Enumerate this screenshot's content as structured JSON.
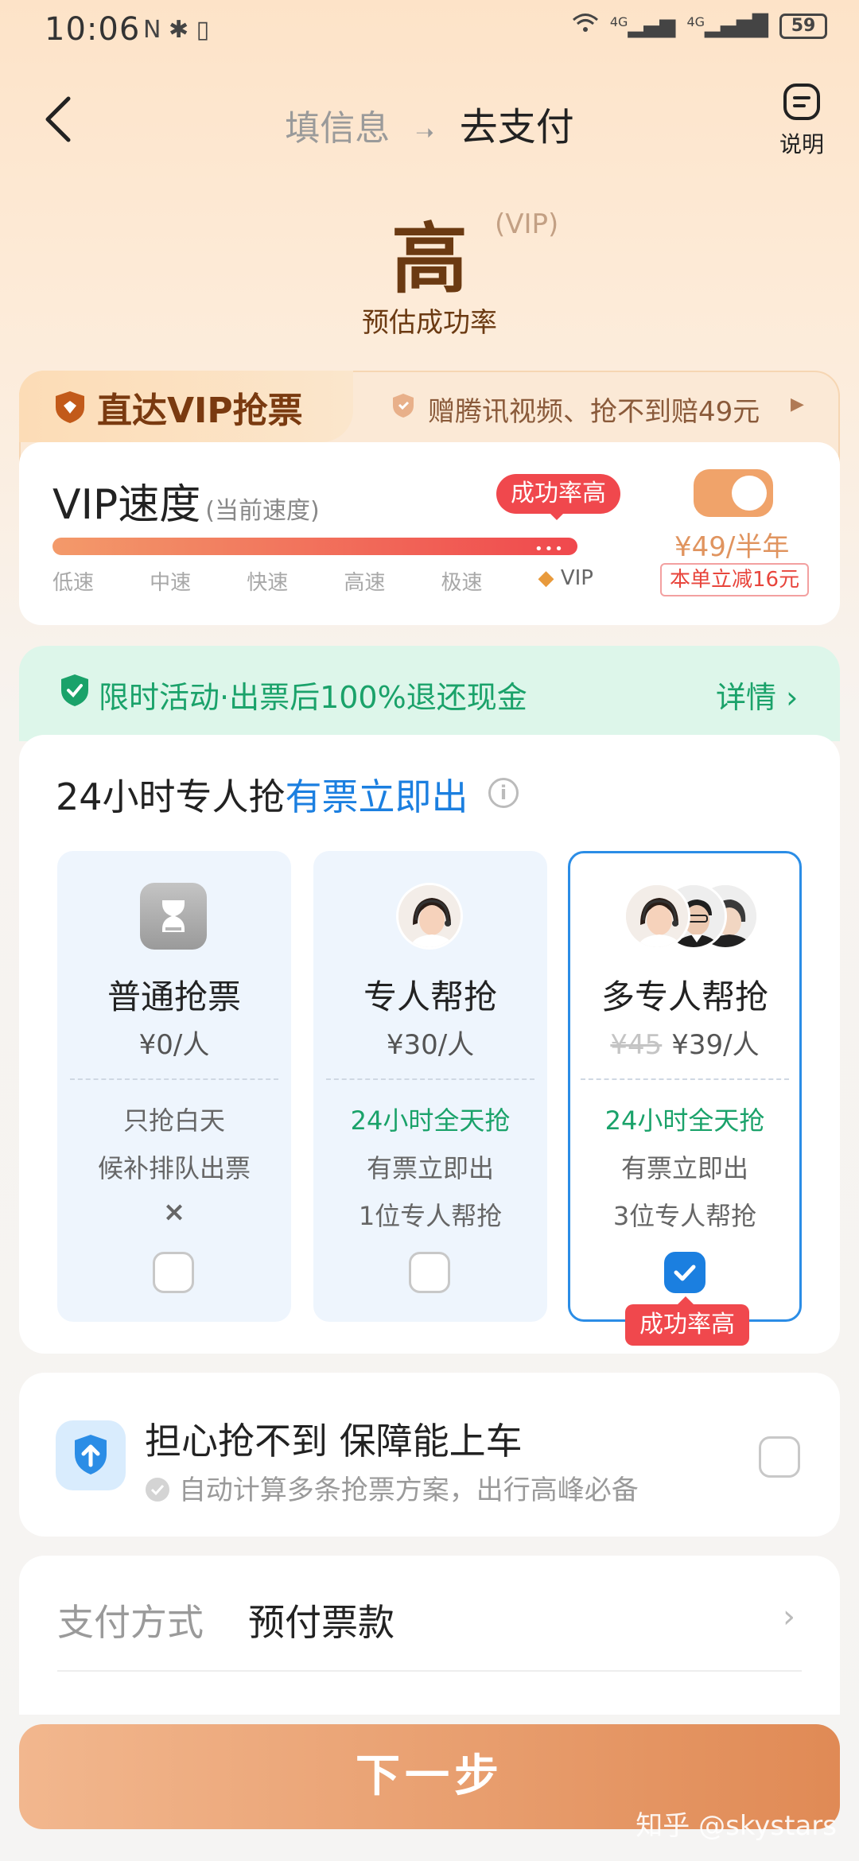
{
  "status_bar": {
    "time": "10:06",
    "left_icons": "N ✱ ▯",
    "signal1": "4G",
    "signal2": "4G",
    "battery": "59"
  },
  "header": {
    "step1": "填信息",
    "step2": "去支付",
    "help_label": "说明"
  },
  "rate": {
    "value": "高",
    "vip_tag": "(VIP)",
    "label": "预估成功率"
  },
  "vip": {
    "tab_label": "直达VIP抢票",
    "promo": "赠腾讯视频、抢不到赔49元",
    "title": "VIP速度",
    "title_sub": "(当前速度)",
    "badge": "成功率高",
    "dots": "•••",
    "speed_labels": [
      "低速",
      "中速",
      "快速",
      "高速",
      "极速",
      "VIP"
    ],
    "price": "¥49/半年",
    "discount": "本单立减16元",
    "toggle_on": true
  },
  "activity": {
    "text": "限时活动·出票后100%退还现金",
    "detail": "详情 ›"
  },
  "service": {
    "title_prefix": "24小时专人抢",
    "title_accent": "有票立即出",
    "info_icon": "i",
    "options": [
      {
        "name": "普通抢票",
        "price": "¥0/人",
        "old_price": "",
        "line1": "只抢白天",
        "line2": "候补排队出票",
        "line3": "×",
        "checked": false
      },
      {
        "name": "专人帮抢",
        "price": "¥30/人",
        "old_price": "",
        "line1": "24小时全天抢",
        "line2": "有票立即出",
        "line3": "1位专人帮抢",
        "checked": false
      },
      {
        "name": "多专人帮抢",
        "price": "¥39/人",
        "old_price": "¥45",
        "line1": "24小时全天抢",
        "line2": "有票立即出",
        "line3": "3位专人帮抢",
        "checked": true
      }
    ],
    "selected_badge": "成功率高"
  },
  "guarantee": {
    "title": "担心抢不到 保障能上车",
    "subtitle": "自动计算多条抢票方案，出行高峰必备"
  },
  "payment": {
    "label": "支付方式",
    "value": "预付票款",
    "arrow": "›"
  },
  "next_button": "下一步",
  "watermark": "知乎 @skystars",
  "colors": {
    "brand_brown": "#6b3a12",
    "accent_blue": "#1b7fe0",
    "success_green": "#1aa26a",
    "badge_red": "#f0484d",
    "cta_orange": "#e08a55"
  }
}
